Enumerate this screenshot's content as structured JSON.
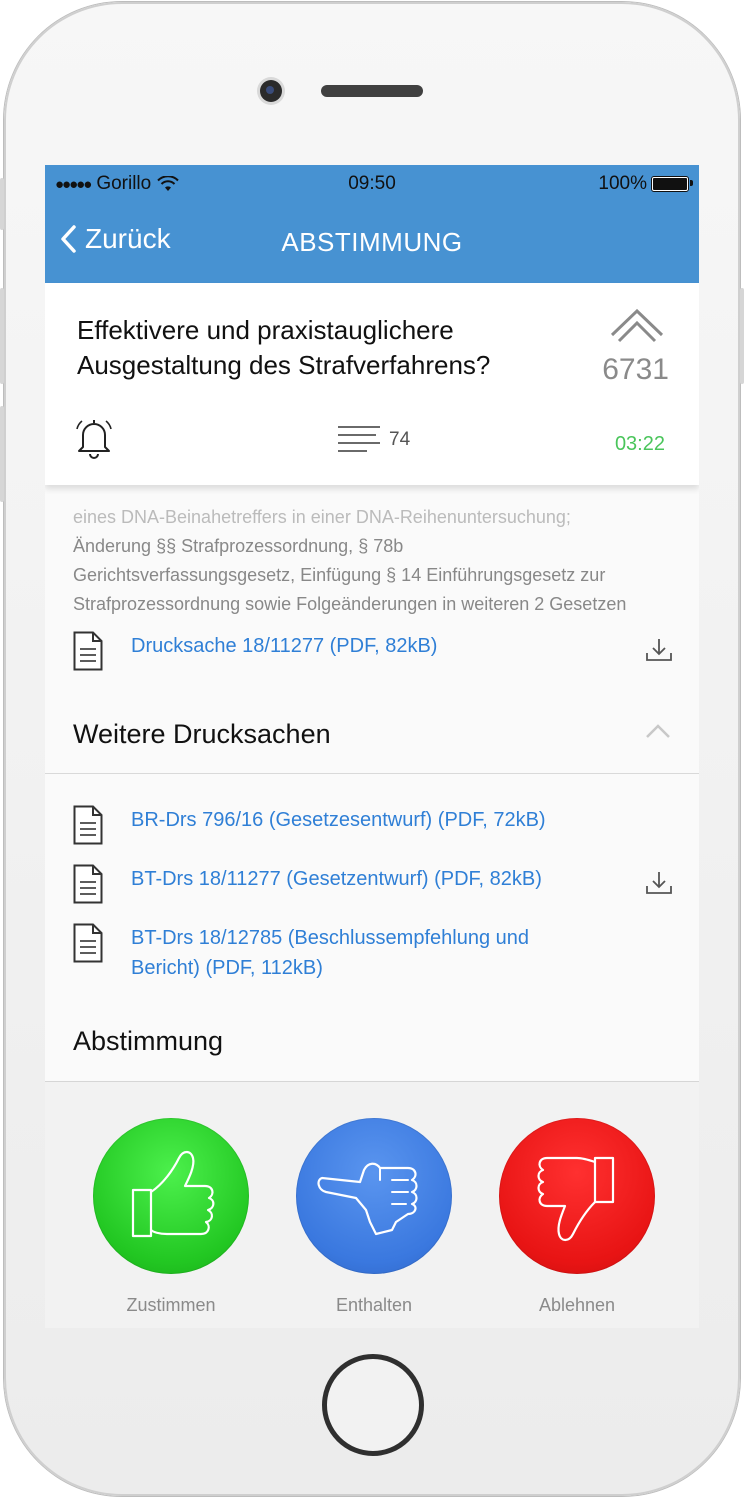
{
  "status_bar": {
    "carrier": "Gorillo",
    "time": "09:50",
    "battery": "100%"
  },
  "nav": {
    "back_label": "Zurück",
    "title": "ABSTIMMUNG"
  },
  "question": {
    "text": "Effektivere und praxistauglichere Ausgestaltung des Strafverfahrens?",
    "votes": "6731",
    "comment_count": "74",
    "timer": "03:22"
  },
  "description": {
    "lines": [
      "eines DNA-Beinahetreffers in einer DNA-Reihenuntersuchung;",
      "Änderung §§ Strafprozessordnung, § 78b",
      "Gerichtsverfassungsgesetz, Einfügung § 14 Einführungsgesetz zur",
      "Strafprozessordnung sowie Folgeänderungen in weiteren 2 Gesetzen"
    ]
  },
  "main_document": {
    "label": "Drucksache 18/11277 (PDF, 82kB)"
  },
  "further_docs": {
    "title": "Weitere Drucksachen",
    "items": [
      {
        "label": "BR-Drs 796/16 (Gesetzesentwurf) (PDF, 72kB)"
      },
      {
        "label": "BT-Drs 18/11277 (Gesetzentwurf) (PDF, 82kB)"
      },
      {
        "label_line1": "BT-Drs 18/12785 (Beschlussempfehlung und",
        "label_line2": "Bericht) (PDF, 112kB)"
      }
    ]
  },
  "vote": {
    "title": "Abstimmung",
    "approve": "Zustimmen",
    "abstain": "Enthalten",
    "reject": "Ablehnen"
  },
  "colors": {
    "navbar": "#4792d2",
    "link": "#2f7fd6",
    "timer": "#4ac55b",
    "approve": "#2ed02e",
    "abstain": "#3f7fe0",
    "reject": "#e81414"
  },
  "icons": [
    "wifi-icon",
    "battery-icon",
    "back-chevron-icon",
    "upvote-chevron-icon",
    "bell-icon",
    "comments-lines-icon",
    "document-icon",
    "download-icon",
    "chevron-up-icon",
    "thumbs-up-icon",
    "thumb-sideways-icon",
    "thumbs-down-icon"
  ]
}
